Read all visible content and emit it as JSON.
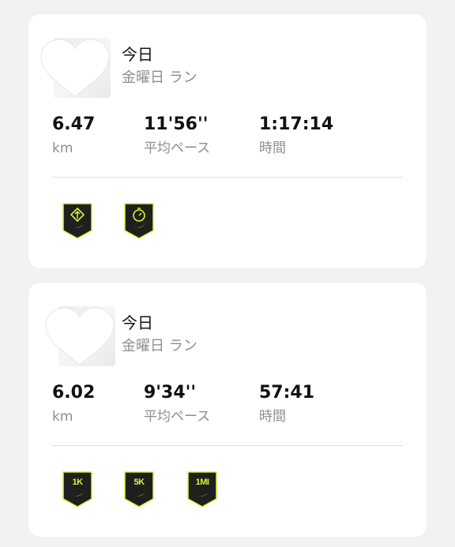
{
  "activities": [
    {
      "date_title": "今日",
      "run_name": "金曜日 ラン",
      "stats": [
        {
          "value": "6.47",
          "label": "km"
        },
        {
          "value": "11'56''",
          "label": "平均ペース"
        },
        {
          "value": "1:17:14",
          "label": "時間"
        }
      ],
      "badges": [
        {
          "icon": "longest-run-icon",
          "label": ""
        },
        {
          "icon": "stopwatch-icon",
          "label": ""
        }
      ]
    },
    {
      "date_title": "今日",
      "run_name": "金曜日 ラン",
      "stats": [
        {
          "value": "6.02",
          "label": "km"
        },
        {
          "value": "9'34''",
          "label": "平均ペース"
        },
        {
          "value": "57:41",
          "label": "時間"
        }
      ],
      "badges": [
        {
          "icon": "1k-badge-icon",
          "label": "1K"
        },
        {
          "icon": "5k-badge-icon",
          "label": "5K"
        },
        {
          "icon": "1mi-badge-icon",
          "label": "1MI"
        }
      ]
    }
  ],
  "colors": {
    "badge_bg": "#1f1f1f",
    "badge_accent": "#d8f337",
    "secondary_text": "#8e8e8e"
  }
}
